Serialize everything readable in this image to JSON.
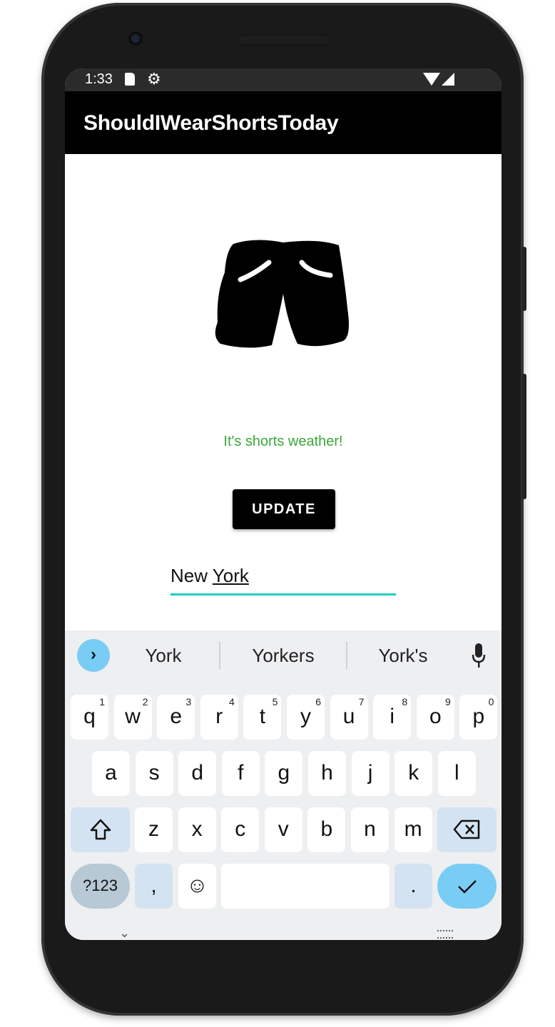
{
  "status_bar": {
    "time": "1:33",
    "icons": [
      "sd-card-icon",
      "debug-gear-icon",
      "wifi-icon",
      "signal-icon"
    ]
  },
  "app_bar": {
    "title": "ShouldIWearShortsToday"
  },
  "main": {
    "image": "shorts-illustration",
    "message": "It's shorts weather!",
    "message_color": "#3aa83a",
    "update_label": "UPDATE",
    "city_field": {
      "value_plain": "New ",
      "value_composing": "York",
      "value": "New York",
      "underline_color": "#1fcfc4"
    }
  },
  "keyboard": {
    "suggestions": [
      "York",
      "Yorkers",
      "York's"
    ],
    "row1": [
      {
        "k": "q",
        "n": "1"
      },
      {
        "k": "w",
        "n": "2"
      },
      {
        "k": "e",
        "n": "3"
      },
      {
        "k": "r",
        "n": "4"
      },
      {
        "k": "t",
        "n": "5"
      },
      {
        "k": "y",
        "n": "6"
      },
      {
        "k": "u",
        "n": "7"
      },
      {
        "k": "i",
        "n": "8"
      },
      {
        "k": "o",
        "n": "9"
      },
      {
        "k": "p",
        "n": "0"
      }
    ],
    "row2": [
      "a",
      "s",
      "d",
      "f",
      "g",
      "h",
      "j",
      "k",
      "l"
    ],
    "row3": [
      "z",
      "x",
      "c",
      "v",
      "b",
      "n",
      "m"
    ],
    "symbols_label": "?123",
    "comma": ",",
    "period": ".",
    "accent_color": "#79cdf5"
  }
}
